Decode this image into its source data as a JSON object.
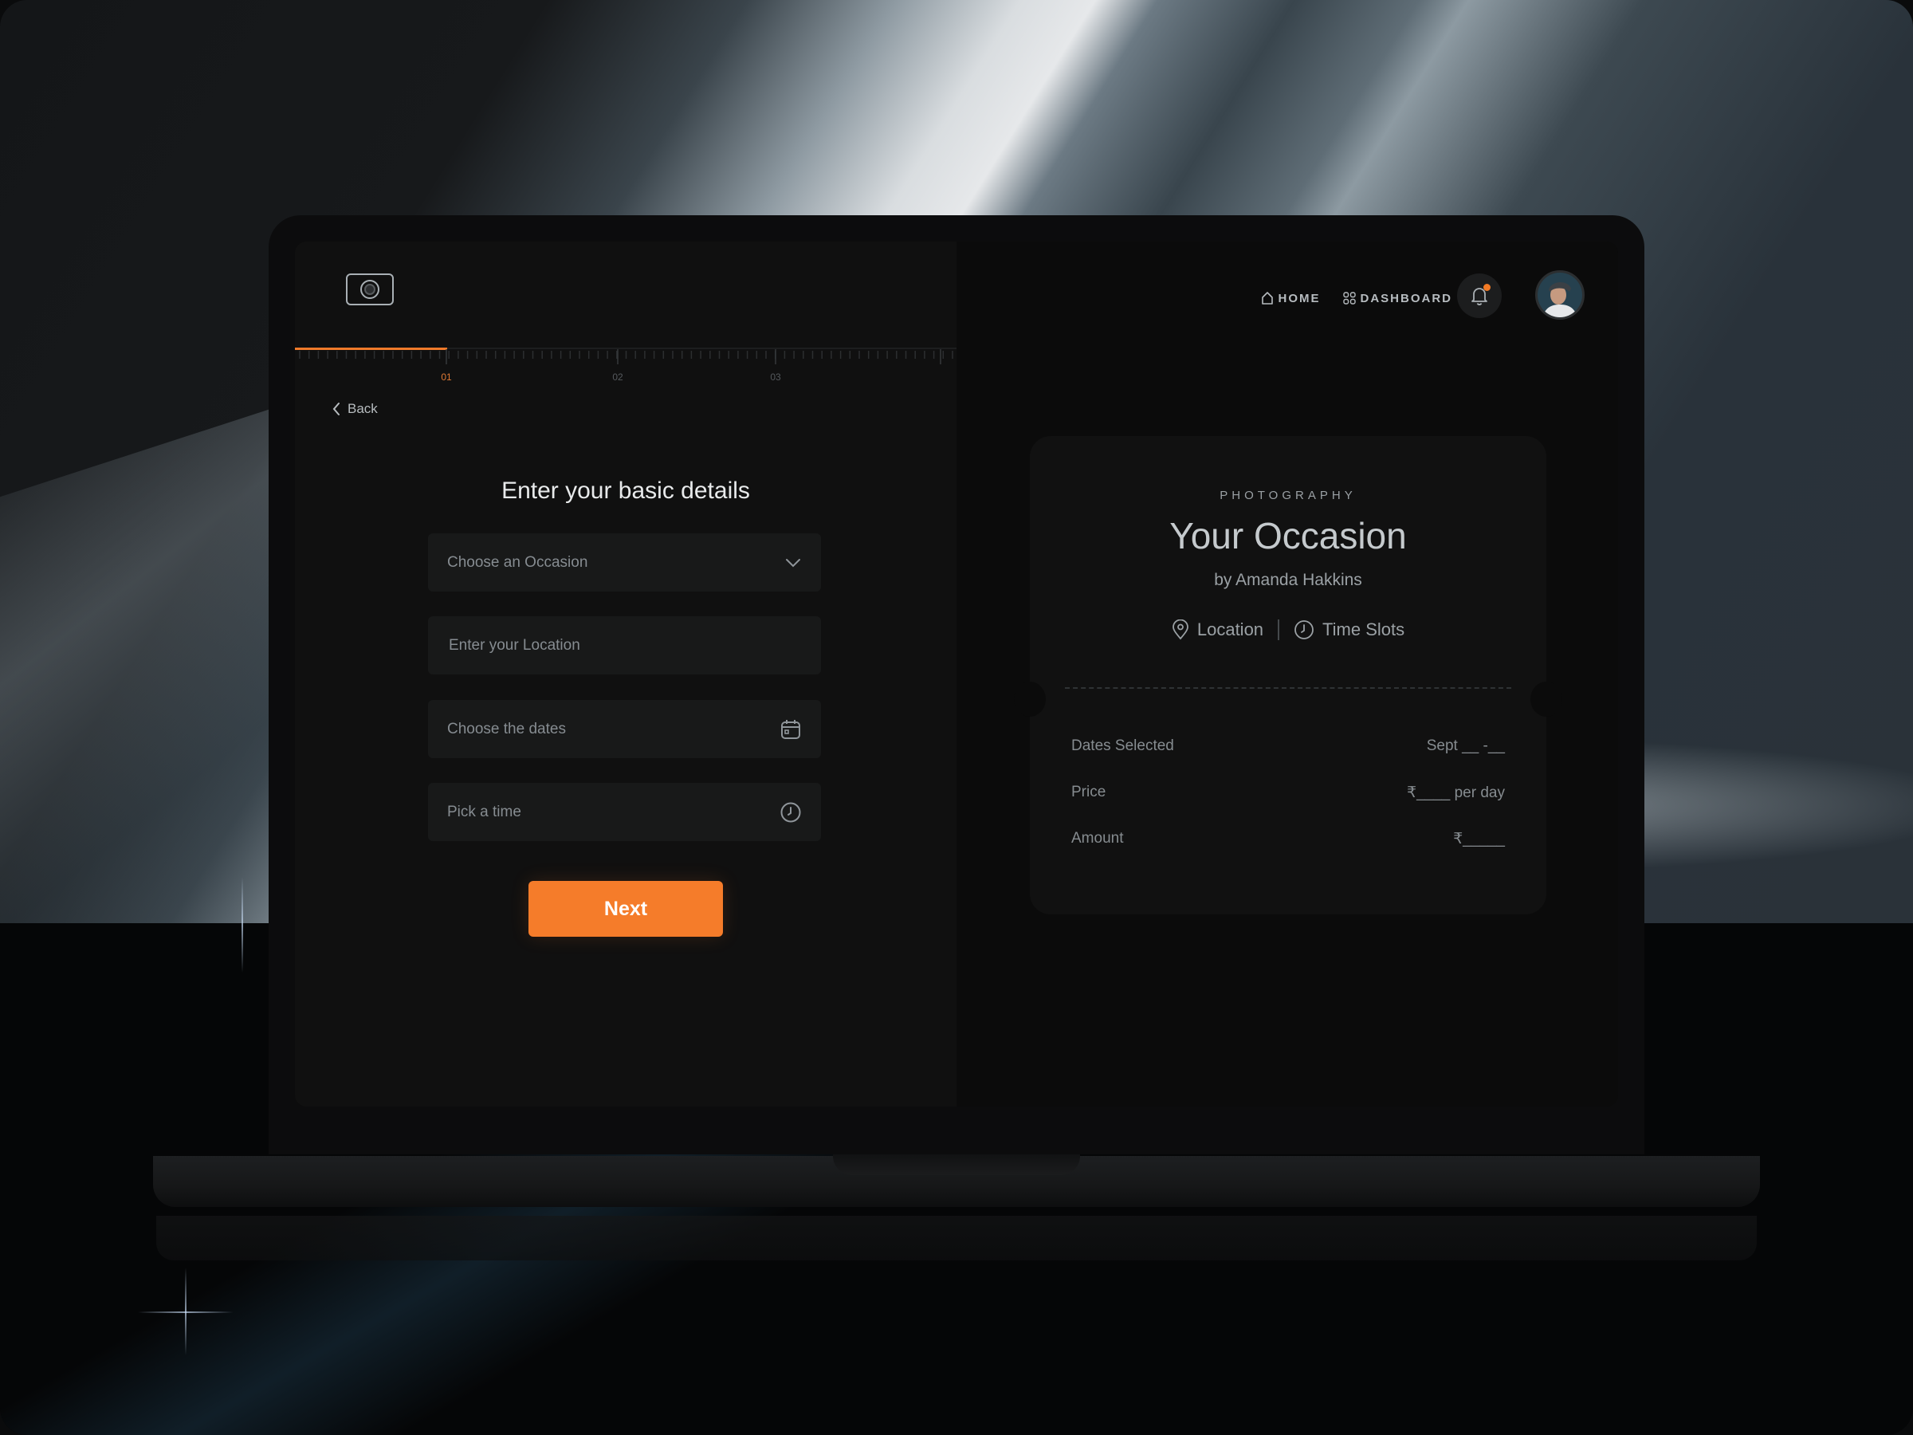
{
  "nav": {
    "home_label": "HOME",
    "dashboard_label": "DASHBOARD",
    "notification_badge": true
  },
  "progress": {
    "steps": [
      "01",
      "02",
      "03"
    ],
    "current_step": 1,
    "fraction_complete": 0.23
  },
  "back_label": "Back",
  "form": {
    "title": "Enter your basic details",
    "occasion_placeholder": "Choose an Occasion",
    "location_placeholder": "Enter your Location",
    "dates_placeholder": "Choose the dates",
    "time_placeholder": "Pick a time",
    "next_label": "Next"
  },
  "summary": {
    "category": "PHOTOGRAPHY",
    "title": "Your Occasion",
    "byline": "by Amanda Hakkins",
    "location_label": "Location",
    "time_slots_label": "Time Slots",
    "rows": [
      {
        "label": "Dates Selected",
        "value": "Sept __ -__"
      },
      {
        "label": "Price",
        "value": "₹____ per day"
      },
      {
        "label": "Amount",
        "value": "₹_____"
      }
    ]
  },
  "colors": {
    "accent": "#f57c2a",
    "screen_bg": "#0b0b0b",
    "panel_bg": "#101010",
    "field_bg": "#181919",
    "card_bg": "#111111"
  }
}
